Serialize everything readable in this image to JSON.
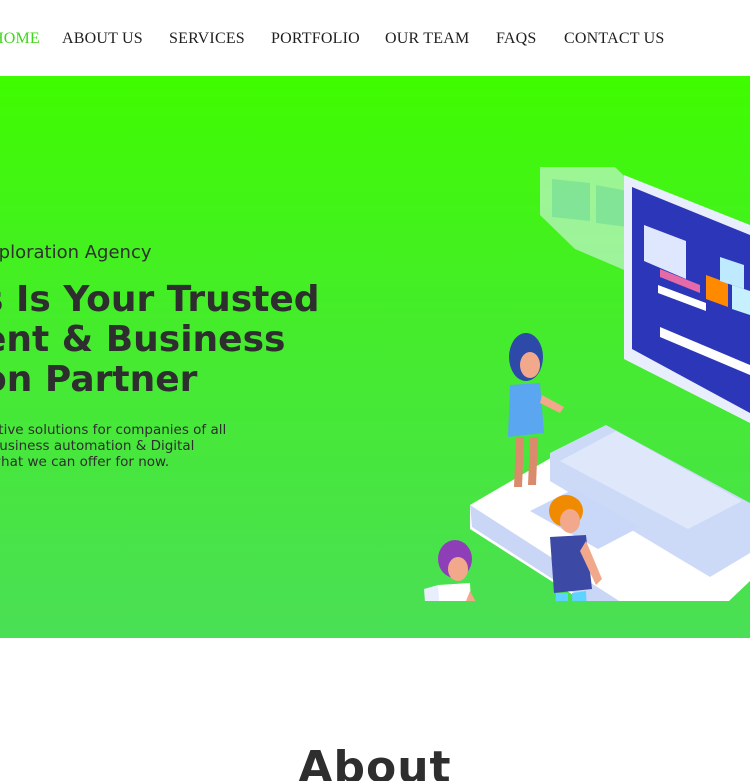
{
  "nav": {
    "items": [
      {
        "label": "HOME",
        "active": true
      },
      {
        "label": "ABOUT US",
        "active": false
      },
      {
        "label": "SERVICES",
        "active": false
      },
      {
        "label": "PORTFOLIO",
        "active": false
      },
      {
        "label": "OUR TEAM",
        "active": false
      },
      {
        "label": "FAQS",
        "active": false
      },
      {
        "label": "CONTACT US",
        "active": false
      }
    ],
    "active_color": "#3fd61a"
  },
  "hero": {
    "kicker": "xploration Agency",
    "headline_lines": [
      "s Is Your Trusted",
      "ent & Business",
      "on Partner"
    ],
    "description_lines": [
      "ative solutions for companies of all",
      "Business automation & Digital",
      "what we can offer for now."
    ],
    "background_colors": [
      "#3ffc00",
      "#4adf56"
    ],
    "illustration": "isometric-laptop-team-illustration"
  },
  "about": {
    "title": "About"
  }
}
